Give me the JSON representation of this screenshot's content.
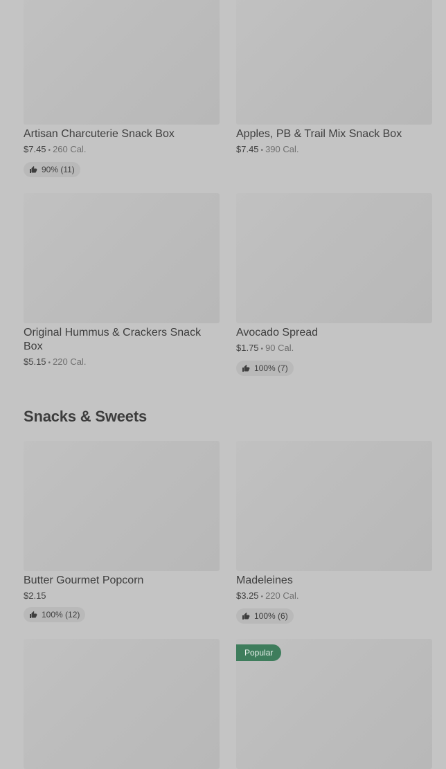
{
  "items_top": [
    {
      "name": "Artisan Charcuterie Snack Box",
      "price": "$7.45",
      "cal": "260 Cal.",
      "rating": "90% (11)"
    },
    {
      "name": "Apples, PB & Trail Mix Snack Box",
      "price": "$7.45",
      "cal": "390 Cal.",
      "rating": null
    },
    {
      "name": "Original Hummus & Crackers Snack Box",
      "price": "$5.15",
      "cal": "220 Cal.",
      "rating": null
    },
    {
      "name": "Avocado Spread",
      "price": "$1.75",
      "cal": "90 Cal.",
      "rating": "100% (7)"
    }
  ],
  "sections": [
    {
      "title": "Snacks & Sweets"
    }
  ],
  "items_sweets": [
    {
      "name": "Butter Gourmet Popcorn",
      "price": "$2.15",
      "cal": null,
      "rating": "100% (12)"
    },
    {
      "name": "Madeleines",
      "price": "$3.25",
      "cal": "220 Cal.",
      "rating": "100% (6)"
    }
  ],
  "badges": {
    "popular": "Popular"
  },
  "separator": "•",
  "icons": {
    "rating": "thumbs-up-icon"
  },
  "colors": {
    "badge": "#3e7d5c",
    "background": "#c4c4c4"
  }
}
